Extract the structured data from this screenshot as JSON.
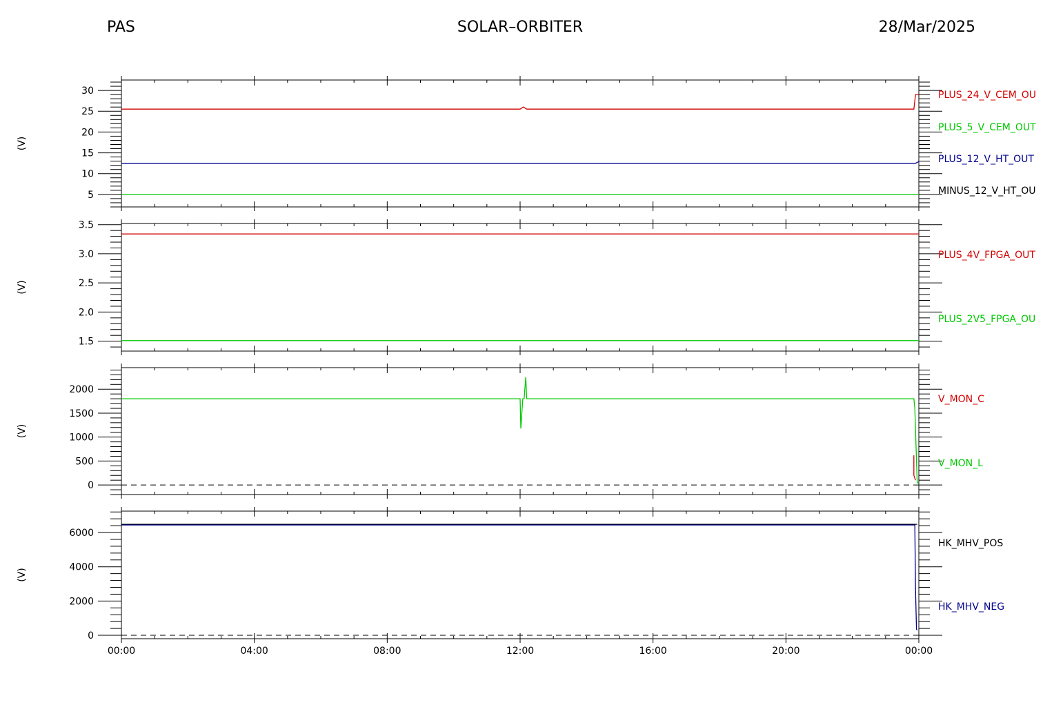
{
  "header": {
    "left": "PAS",
    "center": "SOLAR–ORBITER",
    "right": "28/Mar/2025"
  },
  "x_axis": {
    "ticks": [
      "00:00",
      "04:00",
      "08:00",
      "12:00",
      "16:00",
      "20:00",
      "00:00"
    ]
  },
  "chart_data": [
    {
      "type": "line",
      "ylabel": "(V)",
      "ylim": [
        2,
        32.5
      ],
      "yticks": [
        5,
        10,
        15,
        20,
        25,
        30
      ],
      "ytick_labels": [
        "5",
        "10",
        "15",
        "20",
        "25",
        "30"
      ],
      "xlim_hours": [
        0,
        24
      ],
      "legend": [
        "PLUS_24_V_CEM_OU",
        "PLUS_5_V_CEM_OUT",
        "PLUS_12_V_HT_OUT",
        "MINUS_12_V_HT_OU"
      ],
      "series": [
        {
          "name": "PLUS_24_V_CEM_OU",
          "color": "#d20000",
          "x": [
            0,
            12,
            12.1,
            12.2,
            23.8,
            23.85,
            23.9,
            24
          ],
          "y": [
            25.5,
            25.5,
            26,
            25.5,
            25.5,
            25.5,
            29,
            29
          ]
        },
        {
          "name": "PLUS_5_V_CEM_OUT",
          "color": "#00c800",
          "x": [
            0,
            24
          ],
          "y": [
            5,
            5
          ]
        },
        {
          "name": "PLUS_12_V_HT_OUT",
          "color": "#00008c",
          "x": [
            0,
            23.8,
            23.9,
            24
          ],
          "y": [
            12.5,
            12.5,
            12.5,
            12.9
          ]
        },
        {
          "name": "MINUS_12_V_HT_OU",
          "color": "#000000",
          "x": [],
          "y": []
        }
      ]
    },
    {
      "type": "line",
      "ylabel": "(V)",
      "ylim": [
        1.33,
        3.52
      ],
      "yticks": [
        1.5,
        2.0,
        2.5,
        3.0,
        3.5
      ],
      "ytick_labels": [
        "1.5",
        "2.0",
        "2.5",
        "3.0",
        "3.5"
      ],
      "xlim_hours": [
        0,
        24
      ],
      "legend": [
        "PLUS_4V_FPGA_OUT",
        "PLUS_2V5_FPGA_OU"
      ],
      "series": [
        {
          "name": "PLUS_4V_FPGA_OUT",
          "color": "#d20000",
          "x": [
            0,
            24
          ],
          "y": [
            3.34,
            3.34
          ]
        },
        {
          "name": "PLUS_2V5_FPGA_OU",
          "color": "#00c800",
          "x": [
            0,
            24
          ],
          "y": [
            1.51,
            1.51
          ]
        }
      ]
    },
    {
      "type": "line",
      "ylabel": "(V)",
      "ylim": [
        -200,
        2450
      ],
      "yticks": [
        0,
        500,
        1000,
        1500,
        2000
      ],
      "ytick_labels": [
        "0",
        "500",
        "1000",
        "1500",
        "2000"
      ],
      "xlim_hours": [
        0,
        24
      ],
      "zero_line": true,
      "legend": [
        "V_MON_C",
        "V_MON_L"
      ],
      "series": [
        {
          "name": "V_MON_C",
          "color": "#d20000",
          "x": [
            23.85,
            23.85,
            23.9
          ],
          "y": [
            620,
            200,
            100
          ]
        },
        {
          "name": "V_MON_L",
          "color": "#00c800",
          "x": [
            0,
            12,
            12.02,
            12.08,
            12.12,
            12.17,
            12.2,
            23.85,
            23.88,
            23.95,
            24
          ],
          "y": [
            1800,
            1800,
            1180,
            1800,
            1800,
            2250,
            1800,
            1800,
            1600,
            60,
            20
          ]
        }
      ]
    },
    {
      "type": "line",
      "ylabel": "(V)",
      "ylim": [
        -200,
        7250
      ],
      "yticks": [
        0,
        2000,
        4000,
        6000
      ],
      "ytick_labels": [
        "0",
        "2000",
        "4000",
        "6000"
      ],
      "xlim_hours": [
        0,
        24
      ],
      "zero_line": true,
      "legend": [
        "HK_MHV_POS",
        "HK_MHV_NEG"
      ],
      "series": [
        {
          "name": "HK_MHV_POS",
          "color": "#000000",
          "x": [
            0,
            23.88,
            23.9,
            23.95
          ],
          "y": [
            6480,
            6480,
            6480,
            6480
          ]
        },
        {
          "name": "HK_MHV_NEG",
          "color": "#00008c",
          "x": [
            0,
            23.88,
            23.9,
            23.93,
            23.95
          ],
          "y": [
            6440,
            6440,
            2700,
            350,
            300
          ]
        }
      ]
    }
  ]
}
